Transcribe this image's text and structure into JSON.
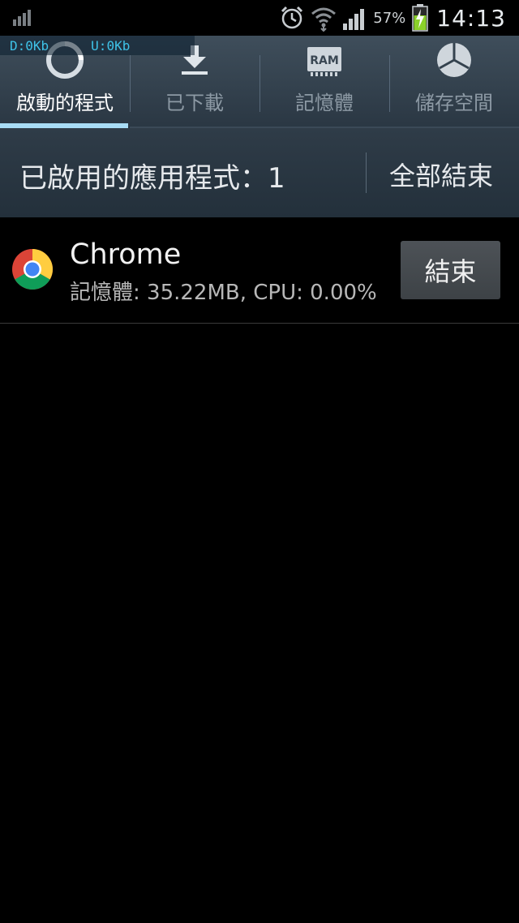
{
  "status_bar": {
    "battery_percent": "57%",
    "time": "14:13",
    "icons": [
      "signal-small-icon",
      "alarm-clock-icon",
      "wifi-icon",
      "cell-signal-icon",
      "battery-charging-icon"
    ]
  },
  "net_speed": {
    "download": "D:0Kb",
    "upload": "U:0Kb"
  },
  "tabs": [
    {
      "label": "啟動的程式",
      "icon": "running-apps-icon",
      "active": true
    },
    {
      "label": "已下載",
      "icon": "download-icon",
      "active": false
    },
    {
      "label": "記憶體",
      "icon": "ram-icon",
      "active": false,
      "icon_text": "RAM"
    },
    {
      "label": "儲存空間",
      "icon": "storage-pie-icon",
      "active": false
    }
  ],
  "header": {
    "title": "已啟用的應用程式：1",
    "end_all": "全部結束"
  },
  "apps": [
    {
      "name": "Chrome",
      "detail": "記憶體: 35.22MB, CPU: 0.00%",
      "end_label": "結束",
      "icon": "chrome-icon"
    }
  ]
}
